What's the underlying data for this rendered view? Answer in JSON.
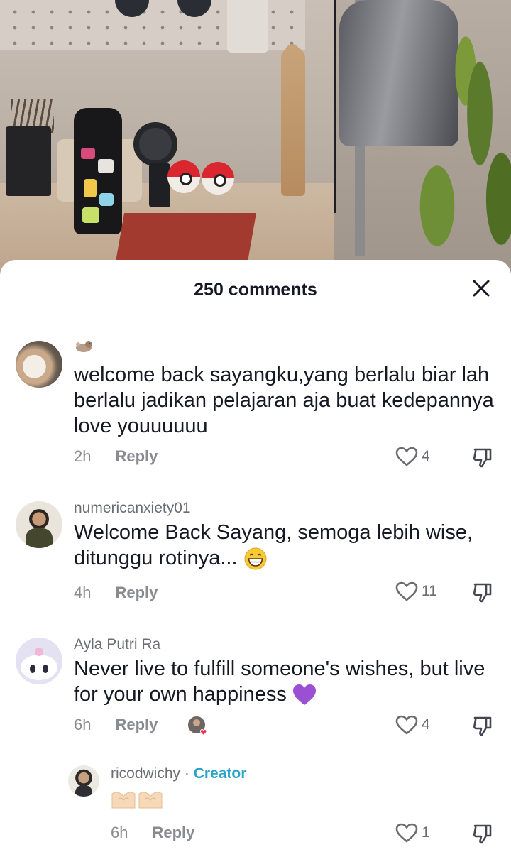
{
  "sheet": {
    "title": "250 comments"
  },
  "comments": [
    {
      "username": "",
      "text": "welcome back sayangku,yang berlalu biar lah berlalu jadikan pelajaran aja buat kedepannya love youuuuuu",
      "time": "2h",
      "reply_label": "Reply",
      "likes": "4"
    },
    {
      "username": "numericanxiety01",
      "text": "Welcome Back Sayang, semoga lebih wise, ditunggu rotinya...",
      "emoji": "grinning-face-emoji",
      "time": "4h",
      "reply_label": "Reply",
      "likes": "11"
    },
    {
      "username": "Ayla Putri Ra",
      "text": "Never live to fulfill someone's wishes, but live for your own happiness",
      "emoji": "purple-heart-emoji",
      "time": "6h",
      "reply_label": "Reply",
      "likes": "4",
      "liked_by_creator": true
    }
  ],
  "reply": {
    "username": "ricodwichy",
    "separator": "·",
    "badge": "Creator",
    "emoji": "heart-hands-emoji",
    "time": "6h",
    "reply_label": "Reply",
    "likes": "1"
  },
  "colors": {
    "creator_badge": "#2aa3c8",
    "meta_gray": "#8a8b91",
    "text": "#161823"
  }
}
